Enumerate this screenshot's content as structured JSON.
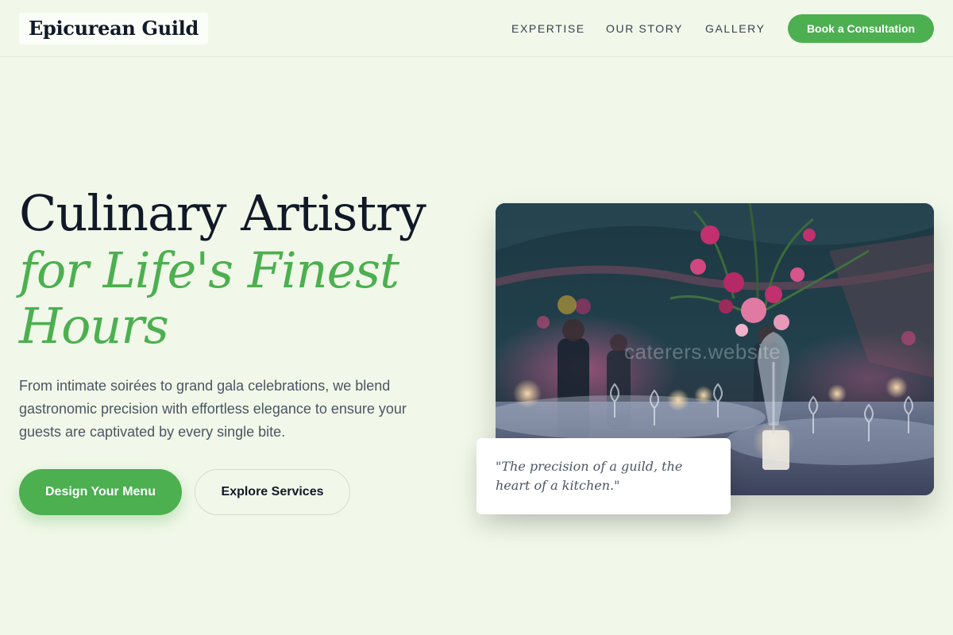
{
  "header": {
    "logo": "Epicurean Guild",
    "nav": [
      {
        "label": "EXPERTISE"
      },
      {
        "label": "OUR STORY"
      },
      {
        "label": "GALLERY"
      }
    ],
    "cta_label": "Book a Consultation"
  },
  "hero": {
    "title_line1": "Culinary Artistry",
    "title_line2": "for Life's Finest Hours",
    "description": "From intimate soirées to grand gala celebrations, we blend gastronomic precision with effortless elegance to ensure your guests are captivated by every single bite.",
    "primary_button": "Design Your Menu",
    "secondary_button": "Explore Services",
    "image_watermark": "caterers.website",
    "quote": "\"The precision of a guild, the heart of a kitchen.\""
  },
  "colors": {
    "background": "#f1f8e9",
    "accent": "#4caf50",
    "heading": "#111827",
    "body_text": "#4b5563"
  }
}
